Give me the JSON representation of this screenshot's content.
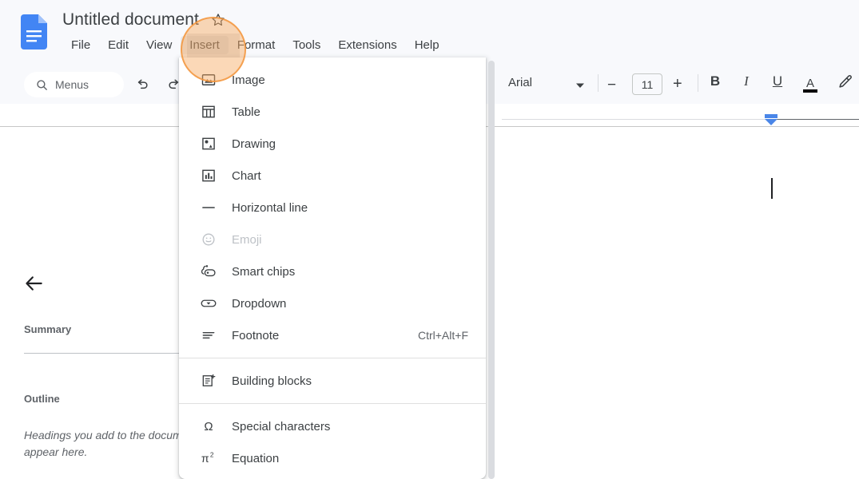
{
  "app": {
    "product": "Google Docs",
    "logo_name": "docs-logo"
  },
  "header": {
    "doc_title": "Untitled document",
    "star_icon": "star-outline-icon",
    "menus": [
      {
        "label": "File",
        "active": false
      },
      {
        "label": "Edit",
        "active": false
      },
      {
        "label": "View",
        "active": false
      },
      {
        "label": "Insert",
        "active": true
      },
      {
        "label": "Format",
        "active": false
      },
      {
        "label": "Tools",
        "active": false
      },
      {
        "label": "Extensions",
        "active": false
      },
      {
        "label": "Help",
        "active": false
      }
    ]
  },
  "toolbar": {
    "search_label": "Menus",
    "search_icon": "search-icon",
    "undo_icon": "undo-icon",
    "redo_icon": "redo-icon",
    "font_name": "Arial",
    "font_caret_icon": "chevron-down-icon",
    "font_size_decrease": "−",
    "font_size": "11",
    "font_size_increase": "+",
    "bold_label": "B",
    "italic_label": "I",
    "underline_label": "U",
    "text_color_label": "A",
    "highlight_icon": "highlighter-pen-icon"
  },
  "sidebar": {
    "back_icon": "back-arrow-icon",
    "summary_heading": "Summary",
    "outline_heading": "Outline",
    "outline_placeholder": "Headings you add to the document will appear here."
  },
  "document": {
    "ruler_name": "ruler",
    "indent_marker_icon": "indent-marker-icon",
    "cursor_name": "text-cursor"
  },
  "insert_menu": {
    "scrollbar_name": "menu-scrollbar",
    "groups": [
      {
        "items": [
          {
            "label": "Image",
            "icon": "image-icon",
            "accel": "",
            "disabled": false
          },
          {
            "label": "Table",
            "icon": "table-icon",
            "accel": "",
            "disabled": false
          },
          {
            "label": "Drawing",
            "icon": "drawing-icon",
            "accel": "",
            "disabled": false
          },
          {
            "label": "Chart",
            "icon": "chart-icon",
            "accel": "",
            "disabled": false
          },
          {
            "label": "Horizontal line",
            "icon": "horizontal-line-icon",
            "accel": "",
            "disabled": false
          },
          {
            "label": "Emoji",
            "icon": "emoji-icon",
            "accel": "",
            "disabled": true
          },
          {
            "label": "Smart chips",
            "icon": "smart-chips-icon",
            "accel": "",
            "disabled": false
          },
          {
            "label": "Dropdown",
            "icon": "dropdown-icon",
            "accel": "",
            "disabled": false
          },
          {
            "label": "Footnote",
            "icon": "footnote-icon",
            "accel": "Ctrl+Alt+F",
            "disabled": false
          }
        ]
      },
      {
        "items": [
          {
            "label": "Building blocks",
            "icon": "building-blocks-icon",
            "accel": "",
            "disabled": false
          }
        ]
      },
      {
        "items": [
          {
            "label": "Special characters",
            "icon": "omega-icon",
            "accel": "",
            "disabled": false
          },
          {
            "label": "Equation",
            "icon": "equation-icon",
            "accel": "",
            "disabled": false
          }
        ]
      }
    ]
  },
  "annotation": {
    "click_target": "Insert",
    "halo_color": "#f7a860"
  }
}
